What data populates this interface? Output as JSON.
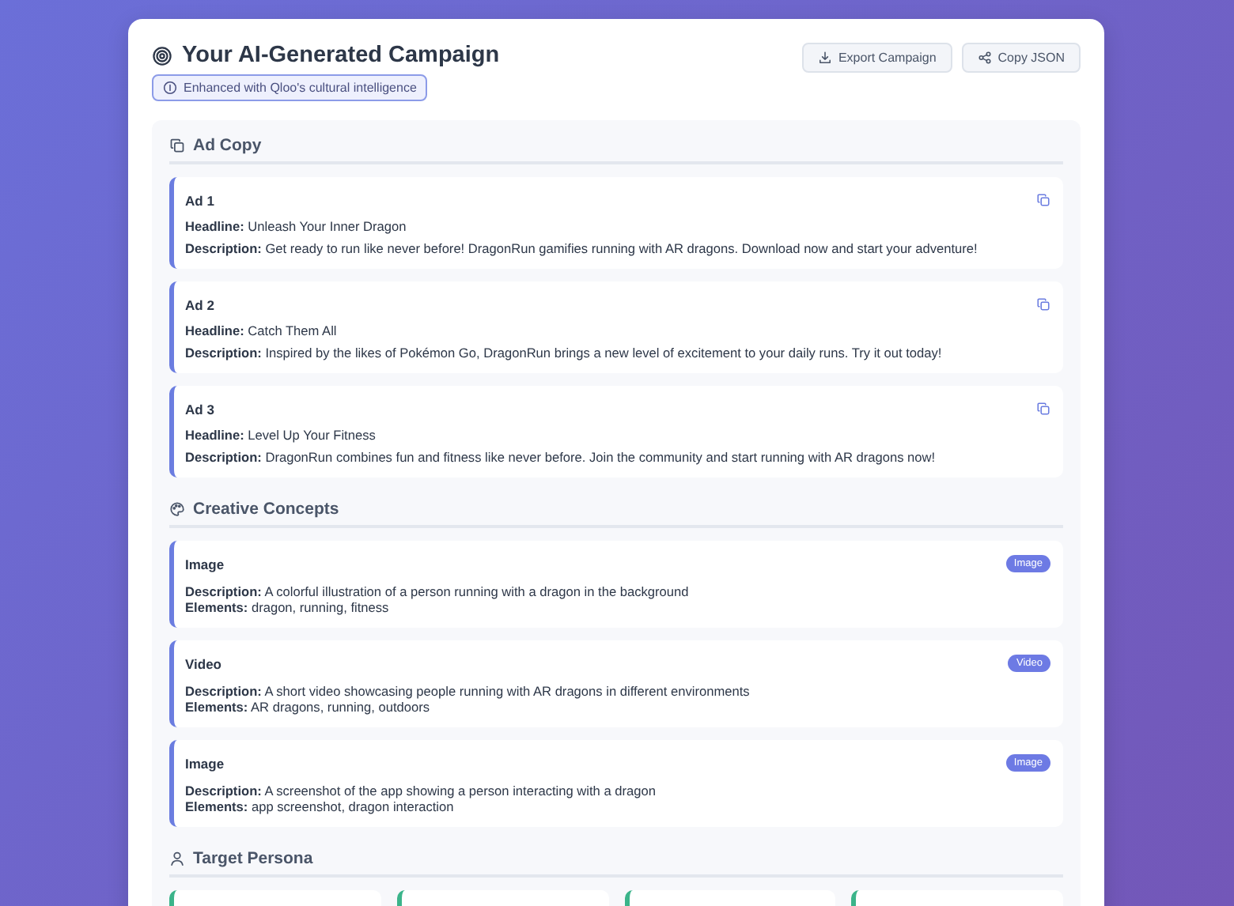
{
  "header": {
    "title": "Your AI-Generated Campaign",
    "badge": "Enhanced with Qloo's cultural intelligence",
    "buttons": [
      {
        "label": "Export Campaign",
        "kind": "export"
      },
      {
        "label": "Copy JSON",
        "kind": "share"
      }
    ]
  },
  "sections": [
    {
      "kind": "ads",
      "title": "Ad Copy",
      "items": [
        {
          "title": "Ad 1",
          "headline_label": "Headline:",
          "headline": "Unleash Your Inner Dragon",
          "description_label": "Description:",
          "description": "Get ready to run like never before! DragonRun gamifies running with AR dragons. Download now and start your adventure!"
        },
        {
          "title": "Ad 2",
          "headline_label": "Headline:",
          "headline": "Catch Them All",
          "description_label": "Description:",
          "description": "Inspired by the likes of Pokémon Go, DragonRun brings a new level of excitement to your daily runs. Try it out today!"
        },
        {
          "title": "Ad 3",
          "headline_label": "Headline:",
          "headline": "Level Up Your Fitness",
          "description_label": "Description:",
          "description": "DragonRun combines fun and fitness like never before. Join the community and start running with AR dragons now!"
        }
      ]
    },
    {
      "kind": "concepts",
      "title": "Creative Concepts",
      "items": [
        {
          "title": "Image",
          "tag": "Image",
          "description_label": "Description:",
          "description": "A colorful illustration of a person running with a dragon in the background",
          "elements_label": "Elements:",
          "elements": "dragon, running, fitness"
        },
        {
          "title": "Video",
          "tag": "Video",
          "description_label": "Description:",
          "description": "A short video showcasing people running with AR dragons in different environments",
          "elements_label": "Elements:",
          "elements": "AR dragons, running, outdoors"
        },
        {
          "title": "Image",
          "tag": "Image",
          "description_label": "Description:",
          "description": "A screenshot of the app showing a person interacting with a dragon",
          "elements_label": "Elements:",
          "elements": "app screenshot, dragon interaction"
        }
      ]
    },
    {
      "kind": "persona",
      "title": "Target Persona"
    }
  ]
}
